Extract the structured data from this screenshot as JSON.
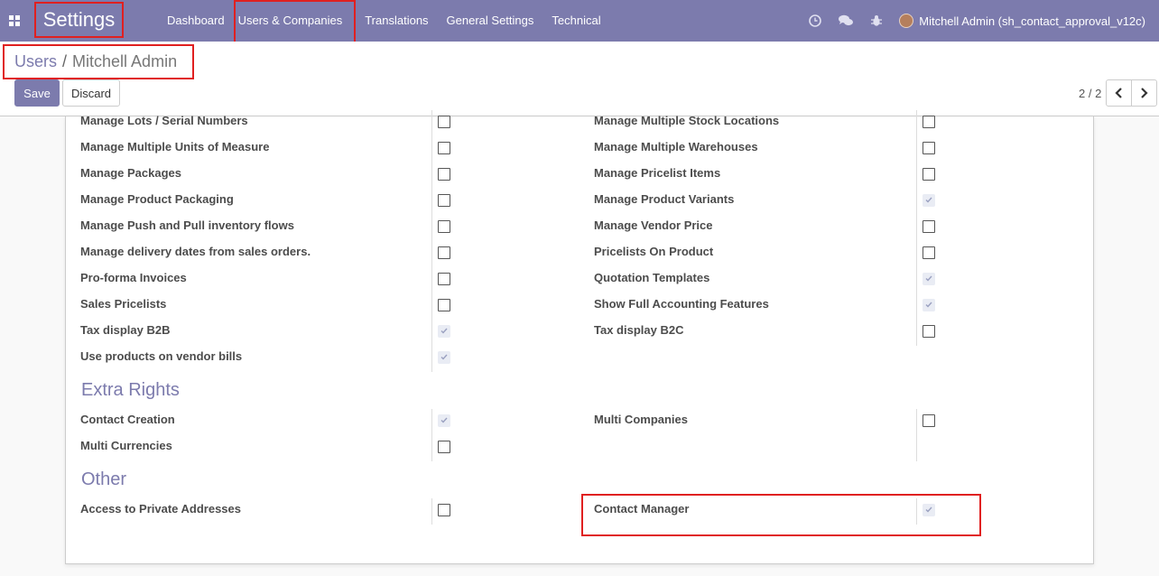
{
  "navbar": {
    "app_title": "Settings",
    "menu": [
      "Dashboard",
      "Users & Companies",
      "Translations",
      "General Settings",
      "Technical"
    ],
    "user_name": "Mitchell Admin (sh_contact_approval_v12c)",
    "bg_color": "#7c7bad"
  },
  "breadcrumb": {
    "parent": "Users",
    "separator": "/",
    "current": "Mitchell Admin"
  },
  "buttons": {
    "save": "Save",
    "discard": "Discard"
  },
  "pager": {
    "value": "2 / 2"
  },
  "rights": {
    "left": [
      {
        "label": "Manage Lots / Serial Numbers",
        "checked": false
      },
      {
        "label": "Manage Multiple Units of Measure",
        "checked": false
      },
      {
        "label": "Manage Packages",
        "checked": false
      },
      {
        "label": "Manage Product Packaging",
        "checked": false
      },
      {
        "label": "Manage Push and Pull inventory flows",
        "checked": false
      },
      {
        "label": "Manage delivery dates from sales orders.",
        "checked": false
      },
      {
        "label": "Pro-forma Invoices",
        "checked": false
      },
      {
        "label": "Sales Pricelists",
        "checked": false
      },
      {
        "label": "Tax display B2B",
        "checked": true
      },
      {
        "label": "Use products on vendor bills",
        "checked": true
      }
    ],
    "right": [
      {
        "label": "Manage Multiple Stock Locations",
        "checked": false
      },
      {
        "label": "Manage Multiple Warehouses",
        "checked": false
      },
      {
        "label": "Manage Pricelist Items",
        "checked": false
      },
      {
        "label": "Manage Product Variants",
        "checked": true
      },
      {
        "label": "Manage Vendor Price",
        "checked": false
      },
      {
        "label": "Pricelists On Product",
        "checked": false
      },
      {
        "label": "Quotation Templates",
        "checked": true
      },
      {
        "label": "Show Full Accounting Features",
        "checked": true
      },
      {
        "label": "Tax display B2C",
        "checked": false
      }
    ]
  },
  "extra_rights": {
    "title": "Extra Rights",
    "left": [
      {
        "label": "Contact Creation",
        "checked": true
      },
      {
        "label": "Multi Currencies",
        "checked": false
      }
    ],
    "right": [
      {
        "label": "Multi Companies",
        "checked": false
      }
    ]
  },
  "other": {
    "title": "Other",
    "left": [
      {
        "label": "Access to Private Addresses",
        "checked": false
      }
    ],
    "right": [
      {
        "label": "Contact Manager",
        "checked": true
      }
    ]
  }
}
